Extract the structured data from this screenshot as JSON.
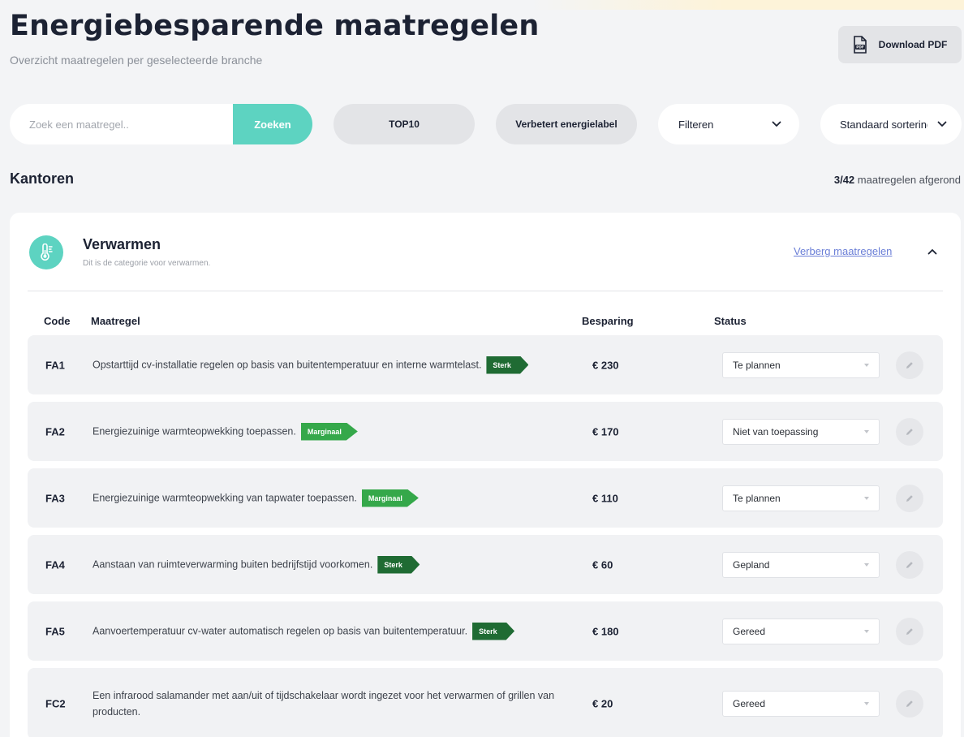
{
  "header": {
    "title": "Energiebesparende maatregelen",
    "subtitle": "Overzicht maatregelen per geselecteerde branche",
    "download_label": "Download PDF",
    "download_icon": "pdf-file-icon"
  },
  "toolbar": {
    "search_placeholder": "Zoek een maatregel..",
    "search_button": "Zoeken",
    "top10_label": "TOP10",
    "energy_label_label": "Verbetert energielabel",
    "filter_label": "Filteren",
    "sort_label": "Standaard sortering"
  },
  "section": {
    "title": "Kantoren",
    "progress_done": "3/42",
    "progress_suffix": "maatregelen afgerond"
  },
  "category": {
    "title": "Verwarmen",
    "description": "Dit is de categorie voor verwarmen.",
    "icon": "thermometer-icon",
    "icon_color": "#5dd3c1",
    "hide_label": "Verberg maatregelen"
  },
  "table": {
    "columns": {
      "code": "Code",
      "measure": "Maatregel",
      "saving": "Besparing",
      "status": "Status"
    },
    "rows": [
      {
        "code": "FA1",
        "text": "Opstarttijd cv-installatie regelen op basis van buitentemperatuur en interne warmtelast.",
        "badge": "Sterk",
        "amount": "€ 230",
        "status": "Te plannen"
      },
      {
        "code": "FA2",
        "text": "Energiezuinige warmteopwekking toepassen.",
        "badge": "Marginaal",
        "amount": "€ 170",
        "status": "Niet van toepassing"
      },
      {
        "code": "FA3",
        "text": "Energiezuinige warmteopwekking van tapwater toepassen.",
        "badge": "Marginaal",
        "amount": "€ 110",
        "status": "Te plannen"
      },
      {
        "code": "FA4",
        "text": "Aanstaan van ruimteverwarming buiten bedrijfstijd voorkomen.",
        "badge": "Sterk",
        "amount": "€ 60",
        "status": "Gepland"
      },
      {
        "code": "FA5",
        "text": "Aanvoertemperatuur cv-water automatisch regelen op basis van buitentemperatuur.",
        "badge": "Sterk",
        "amount": "€ 180",
        "status": "Gereed"
      },
      {
        "code": "FC2",
        "text": "Een infrarood salamander met aan/uit of tijdschakelaar wordt ingezet voor het verwarmen of grillen van producten.",
        "badge": "",
        "amount": "€ 20",
        "status": "Gereed"
      }
    ]
  },
  "colors": {
    "accent": "#5dd3c1",
    "badge_sterk": "#1f6b33",
    "badge_marginaal": "#35a84a",
    "link": "#6b7fd7"
  }
}
